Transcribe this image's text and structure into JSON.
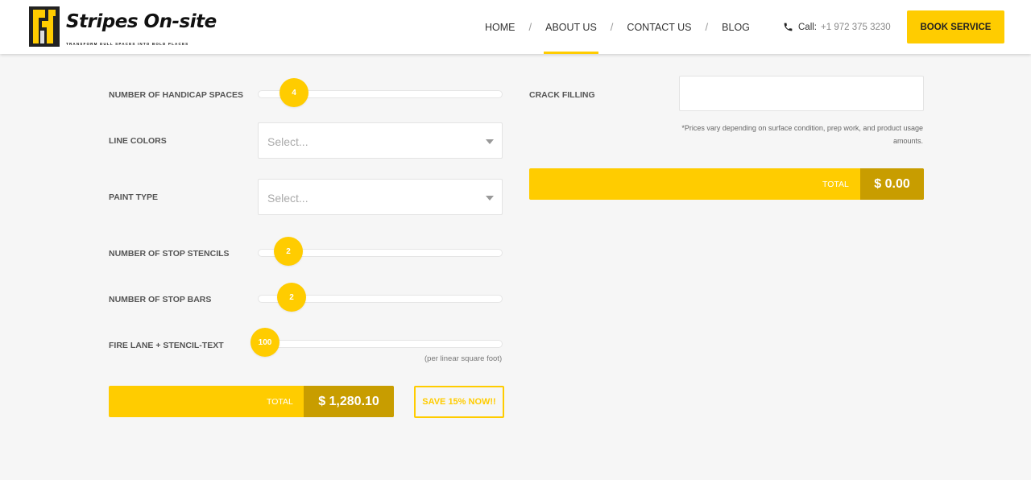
{
  "brand": {
    "name": "Stripes On-site",
    "tagline": "TRANSFORM DULL SPACES INTO BOLD PLACES",
    "accent": "#ffcc00",
    "accent_dark": "#c89d00"
  },
  "nav": {
    "items": [
      {
        "label": "HOME",
        "active": false
      },
      {
        "label": "ABOUT US",
        "active": true
      },
      {
        "label": "CONTACT US",
        "active": false
      },
      {
        "label": "BLOG",
        "active": false
      }
    ],
    "separator": "/",
    "phone_label": "Call:",
    "phone_number": "+1 972 375 3230",
    "phone_icon": "phone-icon",
    "book_label": "BOOK SERVICE"
  },
  "form": {
    "handicap": {
      "label": "NUMBER OF HANDICAP SPACES",
      "value": "4"
    },
    "line_colors": {
      "label": "LINE COLORS",
      "placeholder": "Select..."
    },
    "paint_type": {
      "label": "PAINT TYPE",
      "placeholder": "Select..."
    },
    "stop_stencils": {
      "label": "NUMBER OF STOP STENCILS",
      "value": "2"
    },
    "stop_bars": {
      "label": "NUMBER OF STOP BARS",
      "value": "2"
    },
    "fire_lane": {
      "label": "FIRE LANE + STENCIL-TEXT",
      "value": "100",
      "hint": "(per linear square foot)"
    },
    "total_label": "TOTAL",
    "total_value": "$ 1,280.10",
    "save_label": "SAVE 15% NOW!!"
  },
  "right": {
    "crack_label": "CRACK FILLING",
    "note": "*Prices vary depending on surface condition, prep work, and product usage amounts.",
    "total_label": "TOTAL",
    "total_value": "$ 0.00"
  }
}
